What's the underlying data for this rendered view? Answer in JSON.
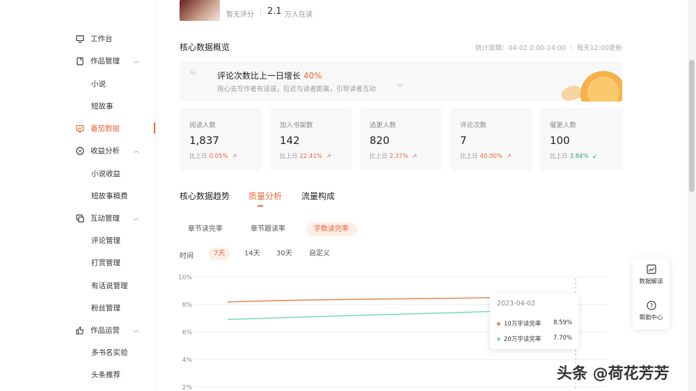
{
  "header": {
    "score_text": "暂无评分",
    "readers_number": "2.1",
    "readers_label": "万人在读"
  },
  "sidebar": {
    "items": [
      {
        "label": "工作台",
        "icon": "monitor-icon"
      },
      {
        "label": "作品管理",
        "icon": "book-icon"
      },
      {
        "label": "小说"
      },
      {
        "label": "短故事"
      },
      {
        "label": "番茄数据",
        "icon": "chart-icon"
      },
      {
        "label": "收益分析",
        "icon": "coin-icon"
      },
      {
        "label": "小说收益"
      },
      {
        "label": "短故事稿费"
      },
      {
        "label": "互动管理",
        "icon": "chat-icon"
      },
      {
        "label": "评论管理"
      },
      {
        "label": "打赏管理"
      },
      {
        "label": "有话说管理"
      },
      {
        "label": "粉丝管理"
      },
      {
        "label": "作品运营",
        "icon": "thumb-icon"
      },
      {
        "label": "多书名实验"
      },
      {
        "label": "头条推荐"
      }
    ]
  },
  "overview": {
    "title": "核心数据概览",
    "period": "统计周期：04-02 0:00-24:00 ｜ 每天12:00更新"
  },
  "banner": {
    "title": "评论次数比上一日增长",
    "percent": "40%",
    "subtitle": "用心去写作者有话说，拉近与读者距离，引导读者互动"
  },
  "stats": [
    {
      "label": "阅读人数",
      "value": "1,837",
      "cmp_label": "比上日",
      "cmp_value": "0.05%",
      "dir": "up"
    },
    {
      "label": "加入书架数",
      "value": "142",
      "cmp_label": "比上日",
      "cmp_value": "22.41%",
      "dir": "up"
    },
    {
      "label": "追更人数",
      "value": "820",
      "cmp_label": "比上日",
      "cmp_value": "2.37%",
      "dir": "up"
    },
    {
      "label": "评论次数",
      "value": "7",
      "cmp_label": "比上日",
      "cmp_value": "40.00%",
      "dir": "up"
    },
    {
      "label": "催更人数",
      "value": "100",
      "cmp_label": "比上日",
      "cmp_value": "3.84%",
      "dir": "down"
    }
  ],
  "tabs": [
    "核心数据趋势",
    "质量分析",
    "流量构成"
  ],
  "sub_tabs": [
    "章节读完率",
    "章节跟读率",
    "字数读完率"
  ],
  "time_range": {
    "label": "时间",
    "options": [
      "7天",
      "14天",
      "30天",
      "自定义"
    ],
    "selected": "7天"
  },
  "chart_data": {
    "type": "line",
    "y_ticks": [
      "10%",
      "8%",
      "6%",
      "4%",
      "2%"
    ],
    "ylim": [
      2,
      10
    ],
    "series": [
      {
        "name": "10万字读完率",
        "color": "#e38a5b",
        "values": [
          8.18,
          8.29,
          8.36,
          8.41,
          8.45,
          8.52,
          8.59
        ]
      },
      {
        "name": "20万字读完率",
        "color": "#7ddcbd",
        "values": [
          6.9,
          7.04,
          7.17,
          7.29,
          7.41,
          7.55,
          7.7
        ]
      }
    ],
    "tooltip": {
      "date": "2023-04-02",
      "rows": [
        {
          "name": "10万字读完率",
          "value": "8.59%"
        },
        {
          "name": "20万字读完率",
          "value": "7.70%"
        }
      ]
    },
    "grid": true
  },
  "float_panel": {
    "data_read_label": "数据解读",
    "help_label": "帮助中心"
  },
  "watermark": "头条 @荷花芳芳",
  "colors": {
    "accent": "#e8683a",
    "green": "#39a36f"
  }
}
